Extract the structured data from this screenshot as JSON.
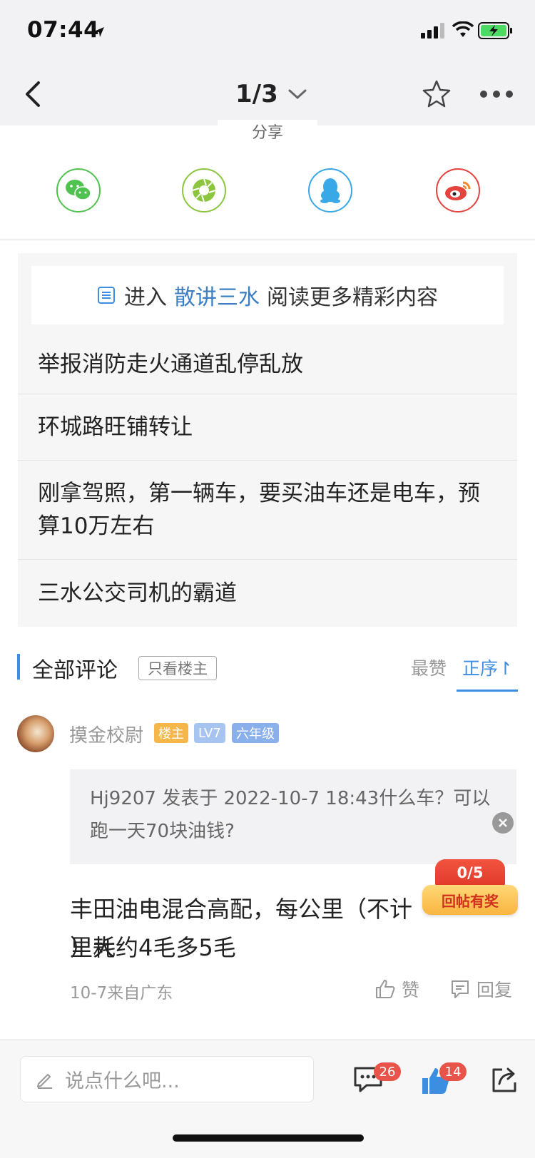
{
  "status_bar": {
    "time": "07:44"
  },
  "nav": {
    "page_indicator": "1/3"
  },
  "share": {
    "label": "分享",
    "targets": [
      "wechat-icon",
      "moments-icon",
      "qq-icon",
      "weibo-icon"
    ]
  },
  "related": {
    "enter_prefix": "进入",
    "forum_name": "散讲三水",
    "enter_suffix": "阅读更多精彩内容",
    "items": [
      {
        "title": "举报消防走火通道乱停乱放"
      },
      {
        "title": "环城路旺铺转让"
      },
      {
        "title": "刚拿驾照，第一辆车，要买油车还是电车，预算10万左右"
      },
      {
        "title": "三水公交司机的霸道"
      }
    ]
  },
  "comments_header": {
    "title": "全部评论",
    "only_op": "只看楼主",
    "sort_top": "最赞",
    "sort_order": "正序↾"
  },
  "comment": {
    "username": "摸金校尉",
    "badge_op": "楼主",
    "badge_level": "LV7",
    "badge_grade": "六年级",
    "quote": "Hj9207 发表于 2022-10-7 18:43什么车？可以跑一天70块油钱?",
    "text_line1": "丰田油电混合高配，每公里（不",
    "text_hidden": "计里耗",
    "text_line2": "）大约4毛多5毛",
    "meta": "10-7来自广东",
    "like_label": "赞",
    "reply_label": "回复"
  },
  "reply_reward": {
    "count": "0/5",
    "label": "回帖有奖"
  },
  "bottom_bar": {
    "input_placeholder": "说点什么吧...",
    "comment_count": "26",
    "like_count": "14"
  },
  "colors": {
    "accent": "#3c8ee0",
    "forum_link": "#3c7fc4",
    "badge_red": "#e8544a"
  }
}
